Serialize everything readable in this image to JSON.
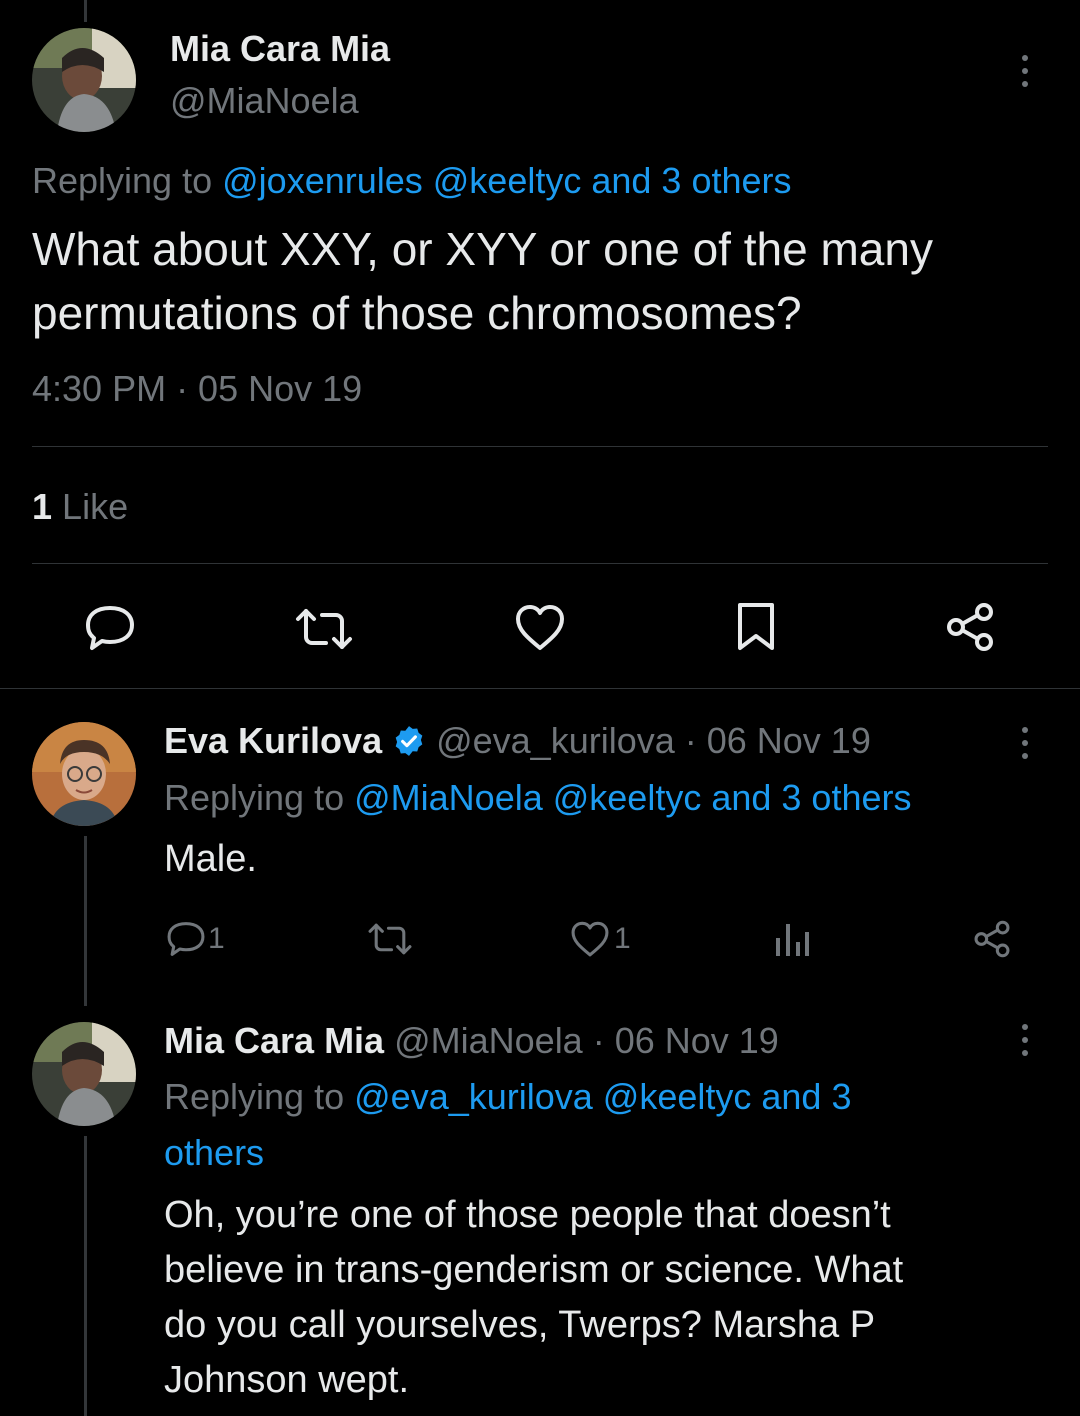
{
  "main_tweet": {
    "author_name": "Mia Cara Mia",
    "author_handle": "@MiaNoela",
    "replying_prefix": "Replying to",
    "replying_to": "@joxenrules @keeltyc and 3 others",
    "text_line1": "What about XXY, or XYY or one of the many",
    "text_line2": "permutations of those chromosomes?",
    "timestamp": "4:30 PM · 05 Nov 19",
    "likes_count": "1",
    "likes_label": "Like",
    "actions": [
      "reply-icon",
      "retweet-icon",
      "like-icon",
      "bookmark-icon",
      "share-icon"
    ]
  },
  "replies": [
    {
      "author_name": "Eva Kurilova",
      "verified": true,
      "author_handle": "@eva_kurilova · 06 Nov 19",
      "replying_prefix": "Replying to",
      "replying_to": "@MiaNoela @keeltyc and 3 others",
      "text": "Male.",
      "reply_count": "1",
      "like_count": "1",
      "actions": [
        "reply-icon",
        "retweet-icon",
        "like-icon",
        "views-icon",
        "share-icon"
      ]
    },
    {
      "author_name": "Mia Cara Mia",
      "author_handle": "@MiaNoela · 06 Nov 19",
      "replying_prefix": "Replying to",
      "replying_to_line1": "@eva_kurilova @keeltyc and 3",
      "replying_to_line2": "others",
      "text_line1": "Oh, you’re one of those people that doesn’t",
      "text_line2": "believe in trans-genderism or science. What",
      "text_line3": "do you call yourselves, Twerps? Marsha P",
      "text_line4": "Johnson wept."
    }
  ],
  "colors": {
    "background": "#000000",
    "text": "#e7e9ea",
    "muted": "#71767b",
    "link": "#1d9bf0",
    "verified": "#1d9bf0"
  }
}
